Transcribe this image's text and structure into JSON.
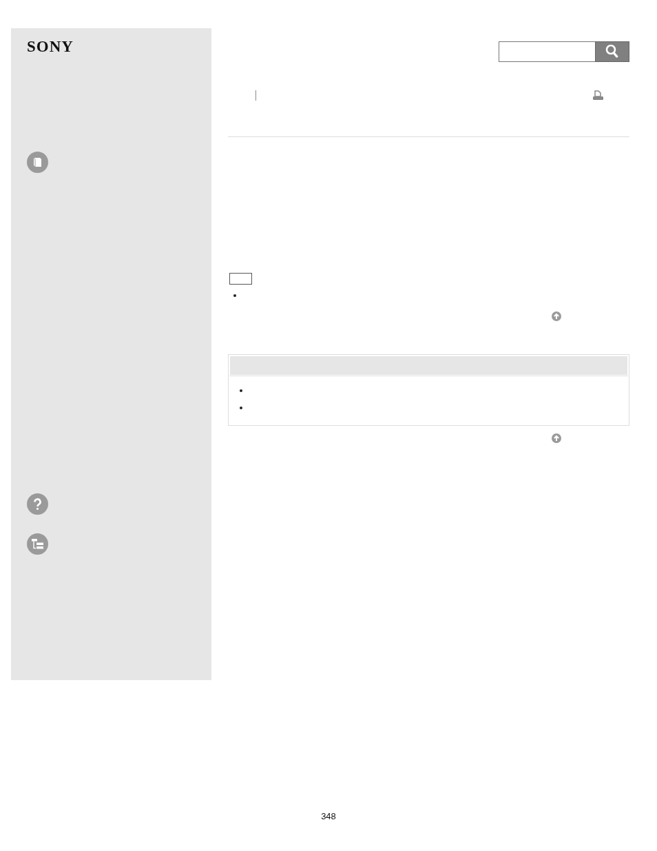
{
  "logo": "SONY",
  "page_number": "348"
}
